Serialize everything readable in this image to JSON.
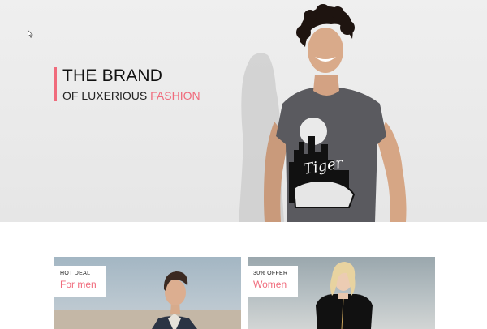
{
  "hero": {
    "headline_line1": "THE BRAND",
    "headline_line2_prefix": "OF LUXERIOUS ",
    "headline_line2_highlight": "FASHION",
    "accent_color": "#f06b7c",
    "shirt_print_text": "Tiger"
  },
  "promos": [
    {
      "tag": "HOT DEAL",
      "title": "For men"
    },
    {
      "tag": "30% OFFER",
      "title": "Women"
    }
  ]
}
